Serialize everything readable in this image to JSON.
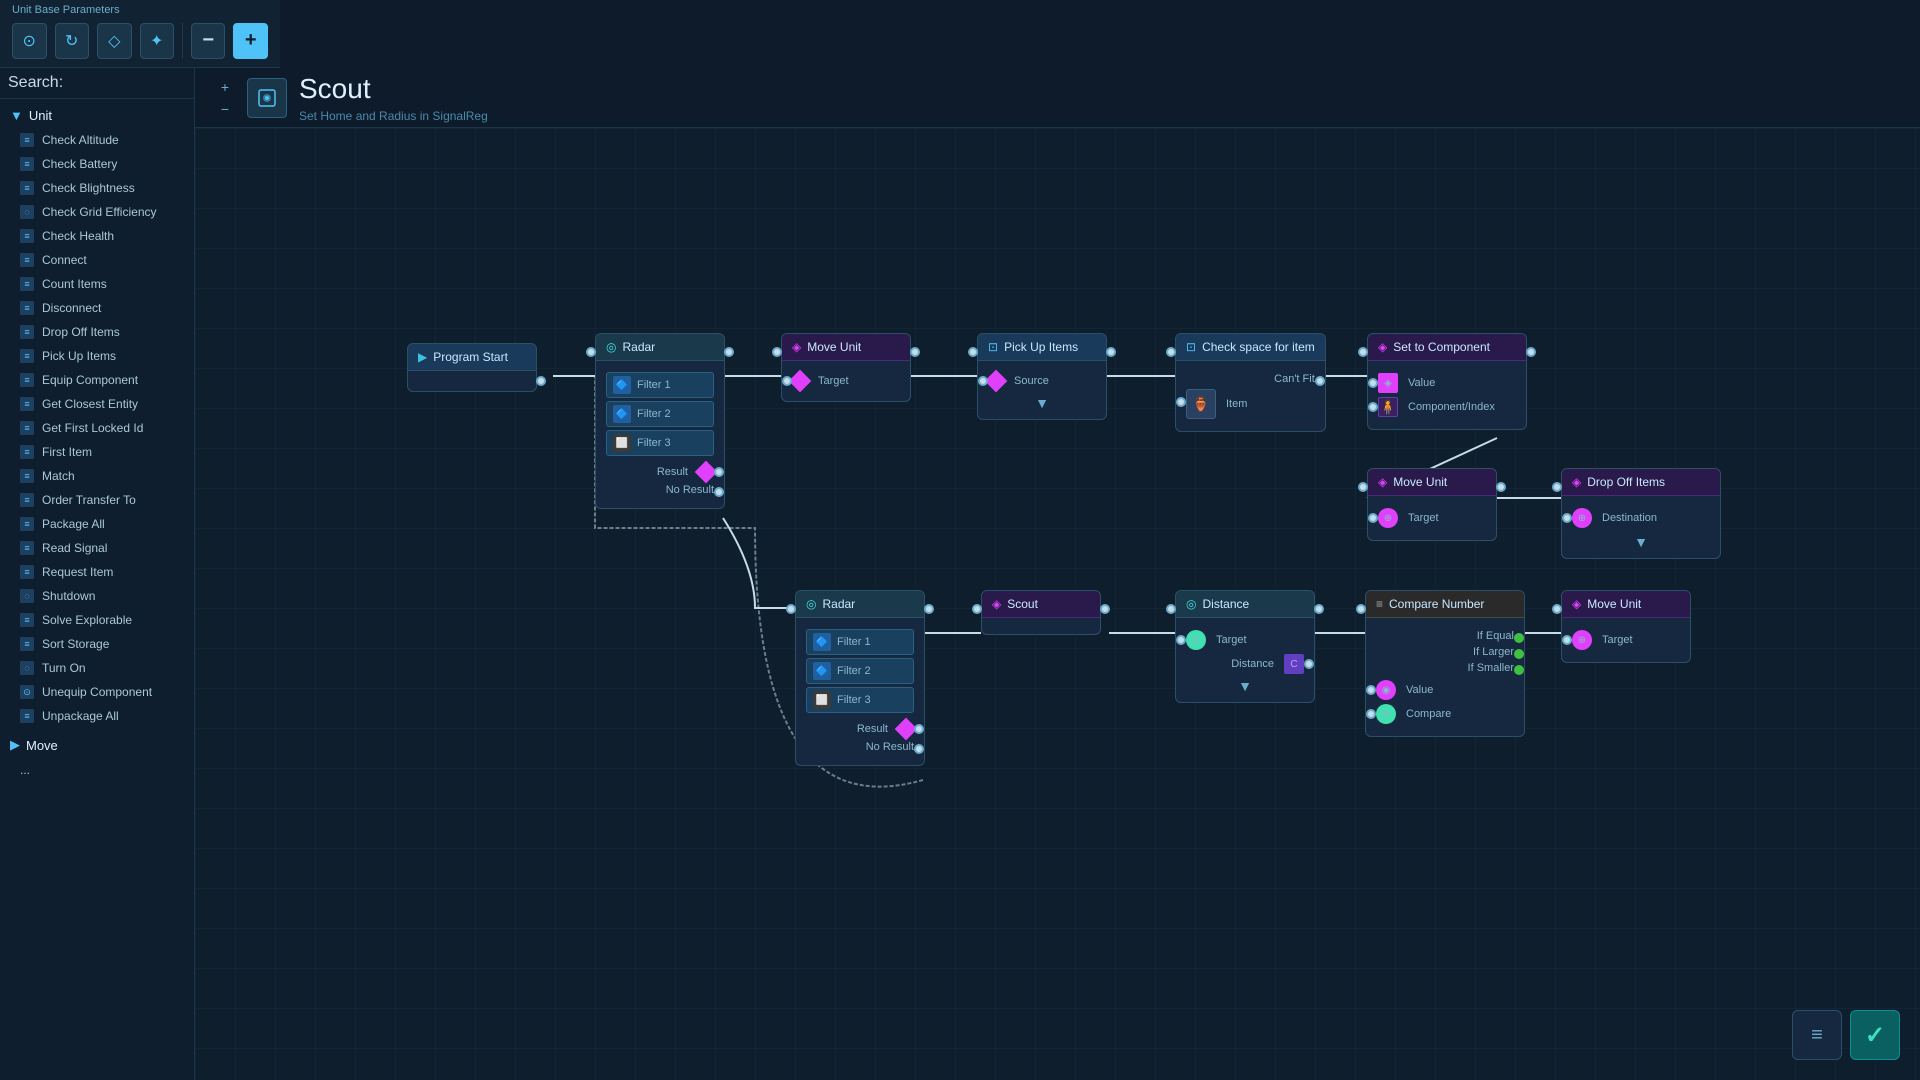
{
  "toolbar": {
    "title": "Unit Base Parameters",
    "icons": [
      "⊙",
      "↻",
      "◇",
      "✦"
    ],
    "minus": "−",
    "plus": "+"
  },
  "header": {
    "title": "Scout",
    "subtitle": "Set Home and Radius in SignalReg"
  },
  "search": {
    "label": "Search:",
    "placeholder": ""
  },
  "sidebar": {
    "unit_group": "Unit",
    "items": [
      "Check Altitude",
      "Check Battery",
      "Check Blightness",
      "Check Grid Efficiency",
      "Check Health",
      "Connect",
      "Count Items",
      "Disconnect",
      "Drop Off Items",
      "Pick Up Items",
      "Equip Component",
      "Get Closest Entity",
      "Get First Locked Id",
      "First Item",
      "Match",
      "Order Transfer To",
      "Package All",
      "Read Signal",
      "Request Item",
      "Shutdown",
      "Solve Explorable",
      "Sort Storage",
      "Turn On",
      "Unequip Component",
      "Unpackage All"
    ],
    "move_group": "Move",
    "bottom_item": "..."
  },
  "nodes": {
    "program_start": {
      "label": "Program Start"
    },
    "radar1": {
      "label": "Radar",
      "filters": [
        "Filter 1",
        "Filter 2",
        "Filter 3"
      ],
      "result": "Result",
      "no_result": "No Result"
    },
    "move_unit1": {
      "label": "Move Unit",
      "target": "Target"
    },
    "pick_up_items": {
      "label": "Pick Up Items",
      "source": "Source"
    },
    "check_space": {
      "label": "Check space for item",
      "cant_fit": "Can't Fit",
      "item": "Item"
    },
    "set_to_component": {
      "label": "Set to Component",
      "value": "Value",
      "component_index": "Component/Index"
    },
    "move_unit2": {
      "label": "Move Unit",
      "target": "Target"
    },
    "drop_off_items": {
      "label": "Drop Off Items",
      "destination": "Destination"
    },
    "radar2": {
      "label": "Radar",
      "filters": [
        "Filter 1",
        "Filter 2",
        "Filter 3"
      ],
      "result": "Result",
      "no_result": "No Result"
    },
    "scout": {
      "label": "Scout"
    },
    "distance": {
      "label": "Distance",
      "target": "Target",
      "distance": "Distance"
    },
    "compare_number": {
      "label": "Compare Number",
      "if_equal": "If Equal",
      "if_larger": "If Larger",
      "if_smaller": "If Smaller",
      "value": "Value",
      "compare": "Compare"
    },
    "move_unit3": {
      "label": "Move Unit",
      "target": "Target"
    }
  },
  "bottom_right": {
    "list_icon": "≡",
    "check_icon": "✓"
  }
}
